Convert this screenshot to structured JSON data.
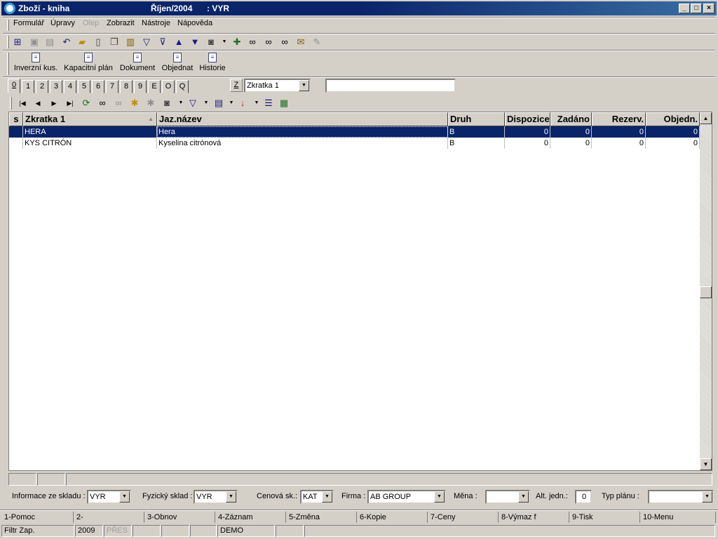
{
  "window": {
    "title": "Zboží - kniha",
    "period": "Říjen/2004",
    "unit": ": VYR",
    "controls": {
      "minimize": "_",
      "maximize": "□",
      "close": "×"
    }
  },
  "menu": {
    "items": [
      "Formulář",
      "Úpravy",
      "Olep",
      "Zobrazit",
      "Nástroje",
      "Nápověda"
    ],
    "disabled": [
      "Olep"
    ]
  },
  "toolbar": {
    "icons": [
      "tree-icon",
      "save-icon",
      "save-as-icon",
      "undo-icon",
      "open-folder-icon",
      "new-document-icon",
      "copy-icon",
      "book-icon",
      "filter-icon",
      "filter-remove-icon",
      "arrow-up-icon",
      "arrow-down-icon",
      "camera-icon",
      "dropdown-arrow-icon",
      "binoculars-arrow-icon",
      "binoculars-icon",
      "binoculars-next-icon",
      "binoculars-replace-icon",
      "mail-icon",
      "edit-disabled-icon"
    ]
  },
  "toolbar2": {
    "buttons": [
      "Inverzní kus.",
      "Kapacitní plán",
      "Dokument",
      "Objednat",
      "Historie"
    ]
  },
  "tabs": [
    "0",
    "1",
    "2",
    "3",
    "4",
    "5",
    "6",
    "7",
    "8",
    "9",
    "E",
    "O",
    "Q"
  ],
  "sort": {
    "z_button": "Z",
    "field": "Zkratka 1",
    "search_value": ""
  },
  "grid": {
    "columns": [
      "s",
      "Zkratka 1",
      "Jaz.název",
      "Druh",
      "Dispozice",
      "Zadáno",
      "Rezerv.",
      "Objedn."
    ],
    "rows": [
      {
        "s": "",
        "zkratka": "HERA",
        "nazev": "Hera",
        "druh": "B",
        "dispozice": "0",
        "zadano": "0",
        "rezerv": "0",
        "objedn": "0",
        "selected": true
      },
      {
        "s": "",
        "zkratka": "KYS CITRÓN",
        "nazev": "Kyselina citrónová",
        "druh": "B",
        "dispozice": "0",
        "zadano": "0",
        "rezerv": "0",
        "objedn": "0",
        "selected": false
      }
    ]
  },
  "filters": {
    "info_sklad_label": "Informace ze skladu :",
    "info_sklad_value": "VYR",
    "fyz_sklad_label": "Fyzický sklad :",
    "fyz_sklad_value": "VYR",
    "cenova_label": "Cenová sk.:",
    "cenova_value": "KAT",
    "firma_label": "Firma :",
    "firma_value": "AB GROUP",
    "mena_label": "Měna :",
    "mena_value": "",
    "alt_label": "Alt. jedn.:",
    "alt_value": "0",
    "typ_label": "Typ plánu :",
    "typ_value": ""
  },
  "fkeys": [
    "1-Pomoc",
    "2-",
    "3-Obnov",
    "4-Záznam",
    "5-Změna",
    "6-Kopie",
    "7-Ceny",
    "8-Výmaz f",
    "9-Tisk",
    "10-Menu"
  ],
  "statusbar": {
    "filter": "Filtr Zap.",
    "year": "2009",
    "mode": "PŘES",
    "db": "DEMO"
  }
}
